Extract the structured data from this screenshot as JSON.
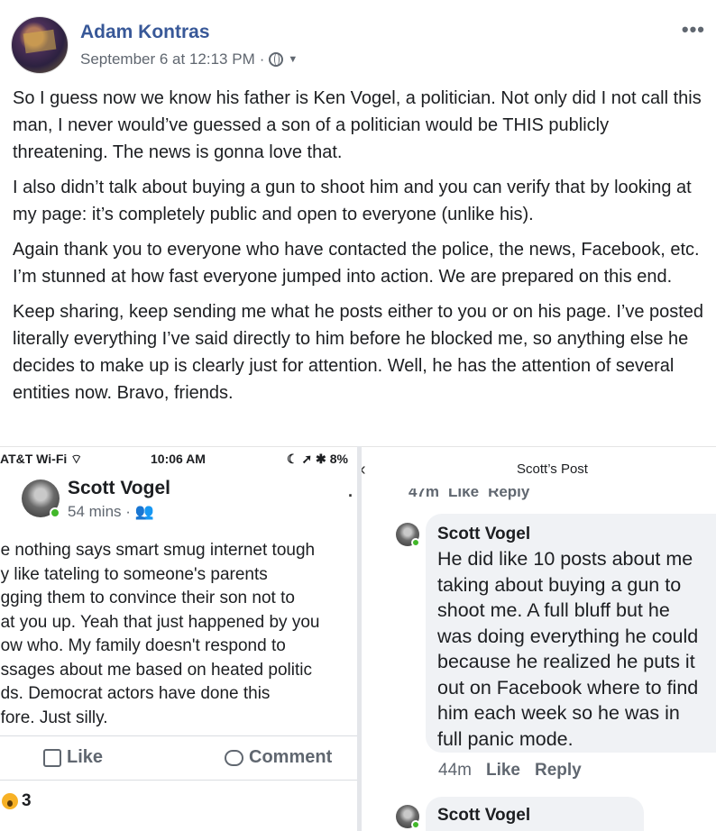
{
  "post": {
    "author": "Adam Kontras",
    "timestamp": "September 6 at 12:13 PM",
    "separator": "·",
    "privacy_icon": "globe-icon",
    "more_icon": "•••",
    "paragraphs": [
      "So I guess now we know his father is Ken Vogel, a politician. Not only did I not call this man, I never would’ve guessed a son of a politician would be THIS publicly threatening. The news is gonna love that.",
      "I also didn’t talk about buying a gun to shoot him and you can verify that by looking at my page: it’s completely public and open to everyone (unlike his).",
      "Again thank you to everyone who have contacted the police, the news, Facebook, etc. I’m stunned at how fast everyone jumped into action. We are prepared on this end.",
      "Keep sharing, keep sending me what he posts either to you or on his page. I’ve posted literally everything I’ve said directly to him before he blocked me, so anything else he decides to make up is clearly just for attention. Well, he has the attention of several entities now. Bravo, friends."
    ]
  },
  "left_screenshot": {
    "statusbar": {
      "carrier": "AT&T Wi-Fi",
      "time": "10:06 AM",
      "right": "8%"
    },
    "name": "Scott Vogel",
    "meta": "54 mins ·",
    "lines": [
      "ee nothing says smart smug internet tough",
      "uy like tateling to someone's parents",
      "egging them to convince their son not to",
      "eat you up. Yeah that just happened by you",
      "now who. My family doesn't respond to",
      "essages about me based on heated politic",
      "uds. Democrat actors have done this",
      "efore. Just silly."
    ],
    "like_label": "Like",
    "comment_label": "Comment",
    "reaction_count": "3"
  },
  "right_screenshot": {
    "title": "Scott’s Post",
    "ghost_row": [
      "47m",
      "Like",
      "Reply"
    ],
    "comment": {
      "name": "Scott Vogel",
      "lines": [
        "He did like 10 posts about me",
        "taking about buying a gun to",
        "shoot me. A full bluff but he",
        "was doing everything he could",
        "because he realized he puts it",
        "out on Facebook where to find",
        "him each week so he was in",
        "full panic mode."
      ],
      "time": "44m",
      "like": "Like",
      "reply": "Reply"
    },
    "comment2_name": "Scott Vogel"
  }
}
